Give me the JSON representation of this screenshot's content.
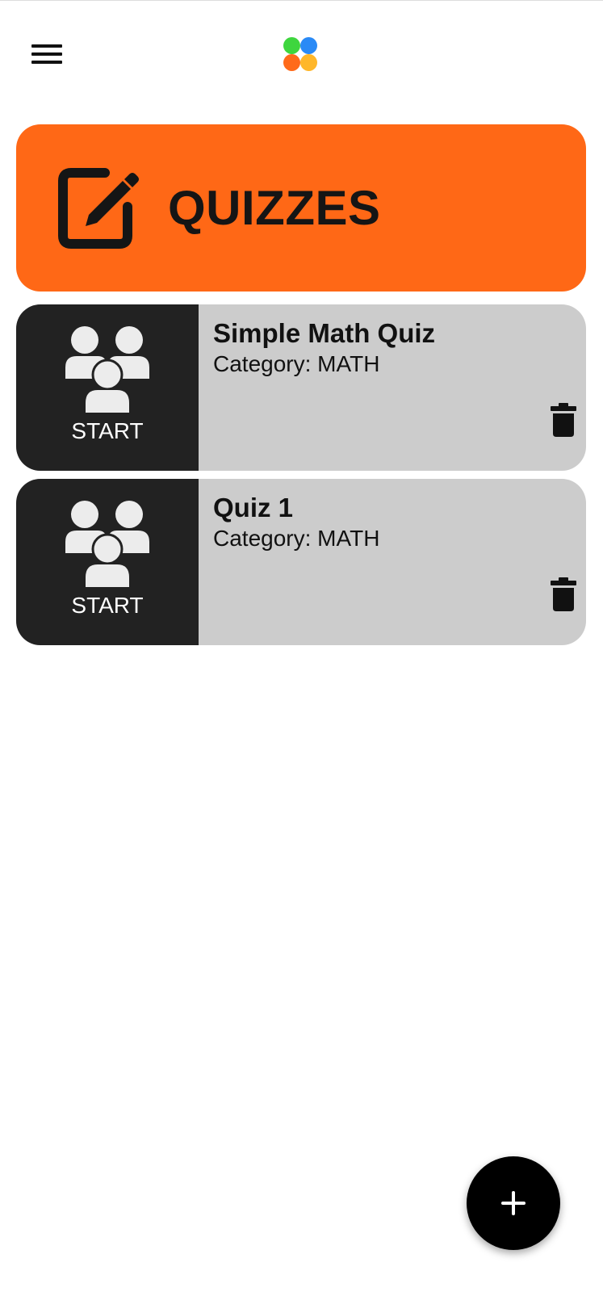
{
  "header": {
    "menu_icon": "hamburger-menu-icon",
    "logo_icon": "four-dot-logo-icon",
    "logo_colors": [
      "#3ed63e",
      "#2a8af6",
      "#ff6a1a",
      "#ffb72a"
    ]
  },
  "banner": {
    "title": "QUIZZES",
    "icon": "edit-square-icon",
    "color": "#ff6816"
  },
  "quizzes": [
    {
      "start_label": "START",
      "start_icon": "group-icon",
      "title": "Simple Math Quiz",
      "category": "Category: MATH",
      "delete_icon": "trash-icon"
    },
    {
      "start_label": "START",
      "start_icon": "group-icon",
      "title": "Quiz 1",
      "category": "Category: MATH",
      "delete_icon": "trash-icon"
    }
  ],
  "fab": {
    "icon": "plus-icon"
  }
}
